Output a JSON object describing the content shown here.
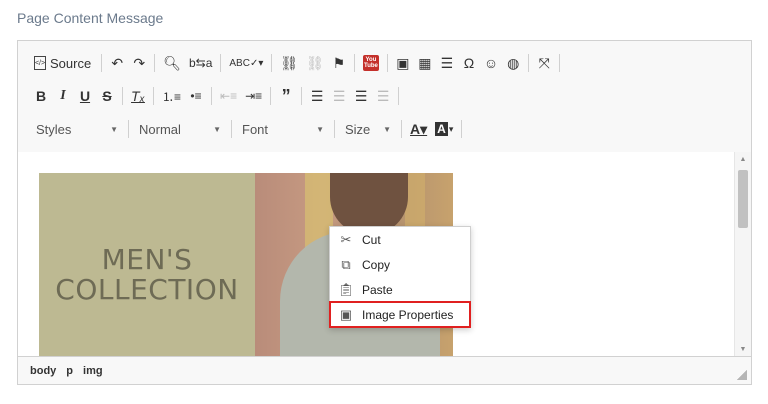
{
  "page_label": "Page Content Message",
  "toolbar": {
    "source_label": "Source",
    "styles_label": "Styles",
    "format_label": "Normal",
    "font_label": "Font",
    "size_label": "Size"
  },
  "image": {
    "line1": "MEN'S",
    "line2": "COLLECTION"
  },
  "context_menu": {
    "items": [
      {
        "label": "Cut",
        "icon": "scissors-icon"
      },
      {
        "label": "Copy",
        "icon": "copy-icon"
      },
      {
        "label": "Paste",
        "icon": "paste-icon"
      },
      {
        "label": "Image Properties",
        "icon": "image-icon"
      }
    ]
  },
  "statusbar": {
    "path": [
      "body",
      "p",
      "img"
    ]
  },
  "colors": {
    "highlight": "#e02020",
    "image_left_bg": "#bdb992",
    "page_label": "#6b7a8c"
  }
}
